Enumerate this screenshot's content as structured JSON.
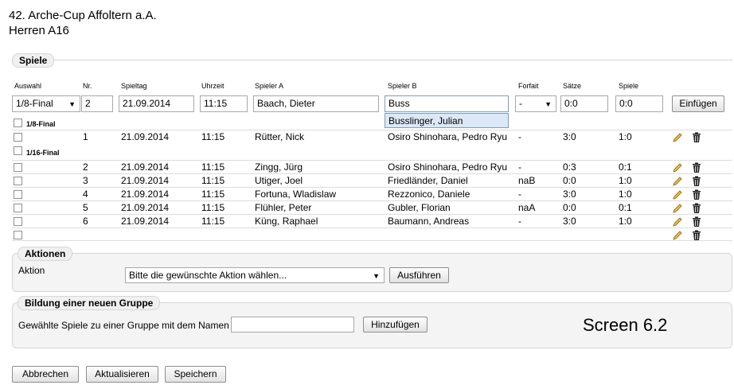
{
  "header": {
    "title_line1": "42. Arche-Cup Affoltern a.A.",
    "title_line2": "Herren A16"
  },
  "spiele": {
    "legend": "Spiele",
    "columns": [
      "Auswahl",
      "Nr.",
      "Spieltag",
      "Uhrzeit",
      "Spieler A",
      "Spieler B",
      "Forfait",
      "Sätze",
      "Spiele"
    ],
    "new_row": {
      "auswahl": "1/8-Final",
      "nr": "2",
      "spieltag": "21.09.2014",
      "uhrzeit": "11:15",
      "spieler_a": "Baach, Dieter",
      "spieler_b": "Buss",
      "forfait": "-",
      "saetze": "0:0",
      "spiele": "0:0",
      "insert_label": "Einfügen"
    },
    "autocomplete": "Busslinger, Julian",
    "groups": [
      {
        "name": "1/8-Final",
        "rows": [
          {
            "nr": "1",
            "spieltag": "21.09.2014",
            "uhrzeit": "11:15",
            "a": "Rütter, Nick",
            "b": "Osiro Shinohara, Pedro Ryu",
            "forfait": "-",
            "saetze": "3:0",
            "spiele": "1:0"
          }
        ]
      },
      {
        "name": "1/16-Final",
        "rows": [
          {
            "nr": "2",
            "spieltag": "21.09.2014",
            "uhrzeit": "11:15",
            "a": "Zingg, Jürg",
            "b": "Osiro Shinohara, Pedro Ryu",
            "forfait": "-",
            "saetze": "0:3",
            "spiele": "0:1"
          },
          {
            "nr": "3",
            "spieltag": "21.09.2014",
            "uhrzeit": "11:15",
            "a": "Utiger, Joel",
            "b": "Friedländer, Daniel",
            "forfait": "naB",
            "saetze": "0:0",
            "spiele": "1:0"
          },
          {
            "nr": "4",
            "spieltag": "21.09.2014",
            "uhrzeit": "11:15",
            "a": "Fortuna, Wladislaw",
            "b": "Rezzonico, Daniele",
            "forfait": "-",
            "saetze": "3:0",
            "spiele": "1:0"
          },
          {
            "nr": "5",
            "spieltag": "21.09.2014",
            "uhrzeit": "11:15",
            "a": "Flühler, Peter",
            "b": "Gubler, Florian",
            "forfait": "naA",
            "saetze": "0:0",
            "spiele": "0:1"
          },
          {
            "nr": "6",
            "spieltag": "21.09.2014",
            "uhrzeit": "11:15",
            "a": "Küng, Raphael",
            "b": "Baumann, Andreas",
            "forfait": "-",
            "saetze": "3:0",
            "spiele": "1:0"
          }
        ]
      }
    ]
  },
  "aktionen": {
    "legend": "Aktionen",
    "label": "Aktion",
    "select_value": "Bitte die gewünschte Aktion wählen...",
    "run_label": "Ausführen"
  },
  "gruppe": {
    "legend": "Bildung einer neuen Gruppe",
    "label": "Gewählte Spiele zu einer Gruppe mit dem Namen",
    "input_value": "",
    "add_label": "Hinzufügen"
  },
  "footer": {
    "cancel": "Abbrechen",
    "refresh": "Aktualisieren",
    "save": "Speichern"
  },
  "screen_label": "Screen 6.2",
  "icons": {
    "edit": "pencil-icon",
    "delete": "trash-icon"
  }
}
